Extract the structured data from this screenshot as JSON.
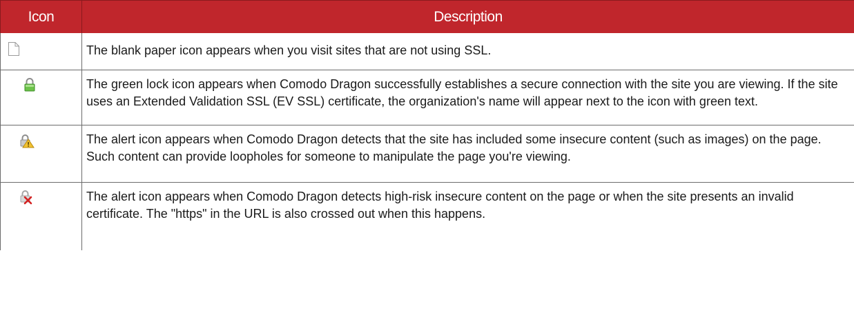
{
  "table": {
    "headers": {
      "icon": "Icon",
      "description": "Description"
    },
    "rows": [
      {
        "icon": "blank-paper-icon",
        "description": "The blank paper icon appears when you visit sites that are not using SSL."
      },
      {
        "icon": "green-lock-icon",
        "description": "The green lock icon appears when Comodo Dragon successfully establishes a secure connection with the site you are viewing. If the site uses an Extended Validation SSL (EV SSL) certificate, the organization's name will appear next to the icon with green text."
      },
      {
        "icon": "lock-alert-icon",
        "description": "The alert icon appears when Comodo Dragon detects that the site has included some insecure content (such as images) on the page. Such content can provide loopholes for someone to manipulate the page you're viewing."
      },
      {
        "icon": "lock-error-icon",
        "description": "The alert icon appears when Comodo Dragon detects high-risk insecure content on the page or when the site presents an invalid certificate. The \"https\" in the URL is also crossed out when this happens."
      }
    ]
  },
  "colors": {
    "header_background": "#c0262c",
    "header_text": "#ffffff",
    "body_text": "#1a1a1a",
    "border": "#6b6b6b",
    "lock_green": "#6cc24a",
    "alert_yellow": "#f2c230",
    "error_red": "#d42020"
  }
}
